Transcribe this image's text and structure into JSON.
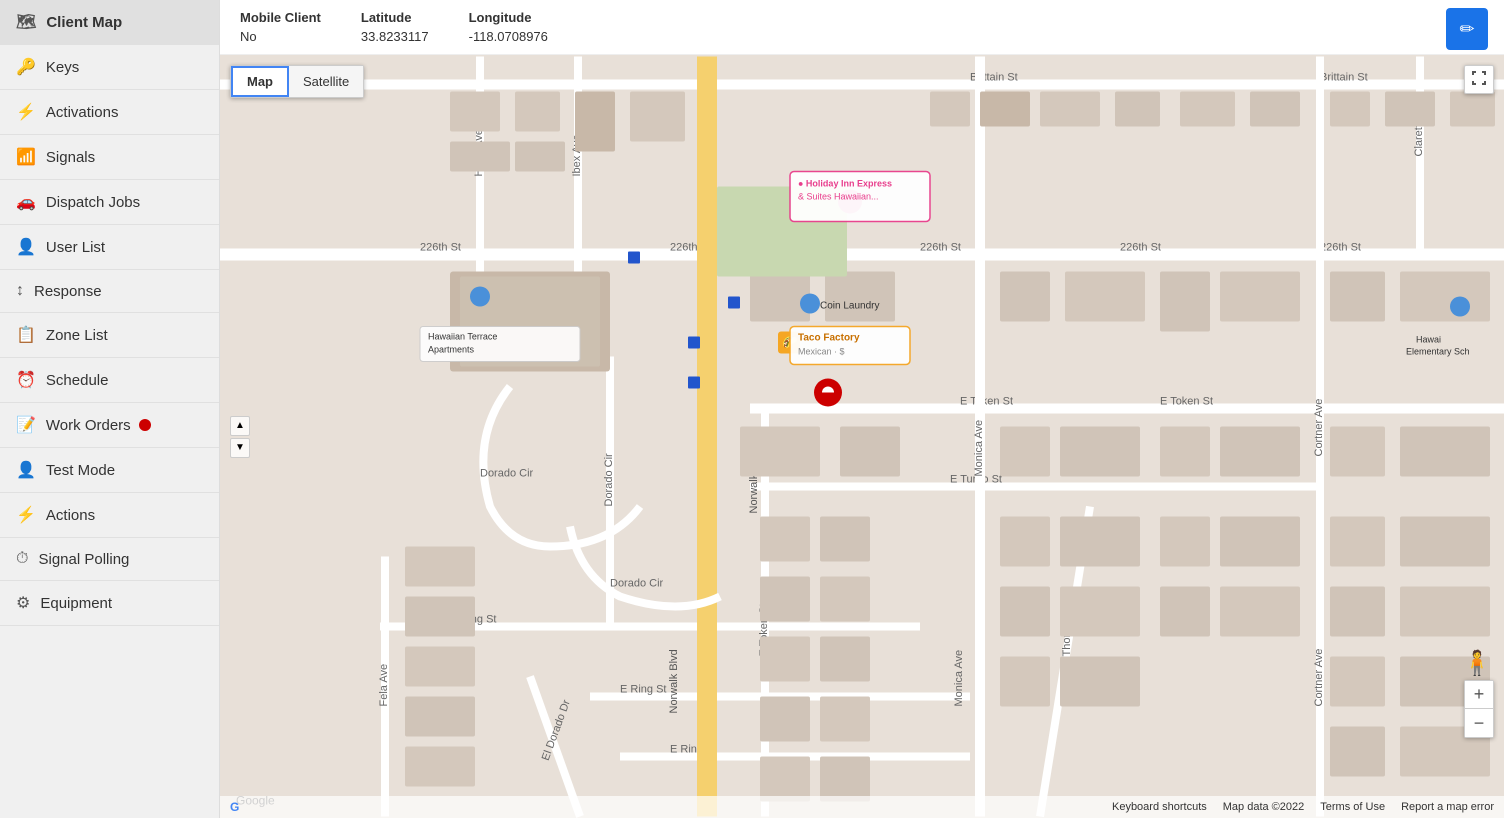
{
  "sidebar": {
    "title": "Client Map",
    "items": [
      {
        "id": "client-map",
        "label": "Client Map",
        "icon": "🗺",
        "active": true
      },
      {
        "id": "keys",
        "label": "Keys",
        "icon": "🔑"
      },
      {
        "id": "activations",
        "label": "Activations",
        "icon": "⚡"
      },
      {
        "id": "signals",
        "label": "Signals",
        "icon": "📶"
      },
      {
        "id": "dispatch-jobs",
        "label": "Dispatch Jobs",
        "icon": "🚗"
      },
      {
        "id": "user-list",
        "label": "User List",
        "icon": "👤"
      },
      {
        "id": "response",
        "label": "Response",
        "icon": "↕"
      },
      {
        "id": "zone-list",
        "label": "Zone List",
        "icon": "📋"
      },
      {
        "id": "schedule",
        "label": "Schedule",
        "icon": "⏰"
      },
      {
        "id": "work-orders",
        "label": "Work Orders",
        "icon": "📝",
        "badge": true
      },
      {
        "id": "test-mode",
        "label": "Test Mode",
        "icon": "👤"
      },
      {
        "id": "actions",
        "label": "Actions",
        "icon": "⚡"
      },
      {
        "id": "signal-polling",
        "label": "Signal Polling",
        "icon": "⏱"
      },
      {
        "id": "equipment",
        "label": "Equipment",
        "icon": "⚙"
      }
    ]
  },
  "info_bar": {
    "columns": [
      {
        "header": "Mobile Client",
        "value": "No"
      },
      {
        "header": "Latitude",
        "value": "33.8233117"
      },
      {
        "header": "Longitude",
        "value": "-118.0708976"
      }
    ]
  },
  "map": {
    "type_buttons": [
      "Map",
      "Satellite"
    ],
    "active_type": "Map",
    "zoom_in_label": "+",
    "zoom_out_label": "−",
    "footer": {
      "google_logo": "Google",
      "keyboard_shortcuts": "Keyboard shortcuts",
      "map_data": "Map data ©2022",
      "terms": "Terms of Use",
      "report": "Report a map error"
    },
    "pan_up": "▲",
    "pan_down": "▼",
    "fullscreen_icon": "⛶"
  },
  "edit_button_label": "✏"
}
